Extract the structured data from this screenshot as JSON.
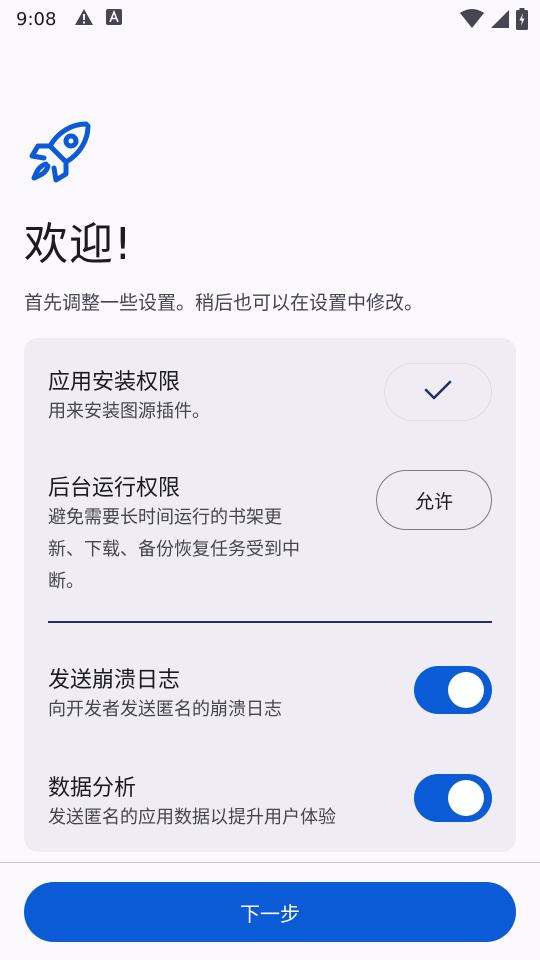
{
  "status_bar": {
    "time": "9:08",
    "icons": [
      "warning-icon",
      "font-a-icon",
      "wifi-icon",
      "signal-icon",
      "battery-icon"
    ]
  },
  "welcome": {
    "title": "欢迎!",
    "subtitle": "首先调整一些设置。稍后也可以在设置中修改。"
  },
  "permissions": {
    "install": {
      "title": "应用安装权限",
      "desc": "用来安装图源插件。",
      "granted": true
    },
    "background": {
      "title": "后台运行权限",
      "desc_line1": "避免需要长时间运行的书架更",
      "desc_line2": "新、下载、备份恢复任务受到中",
      "desc_line3": "断。",
      "button_label": "允许"
    }
  },
  "settings": {
    "crash_log": {
      "title": "发送崩溃日志",
      "desc": "向开发者发送匿名的崩溃日志",
      "enabled": true
    },
    "analytics": {
      "title": "数据分析",
      "desc": "发送匿名的应用数据以提升用户体验",
      "enabled": true
    }
  },
  "footer": {
    "next_label": "下一步"
  },
  "colors": {
    "accent": "#0b5bd6",
    "background": "#fbf8fe",
    "card": "#efecf4"
  }
}
